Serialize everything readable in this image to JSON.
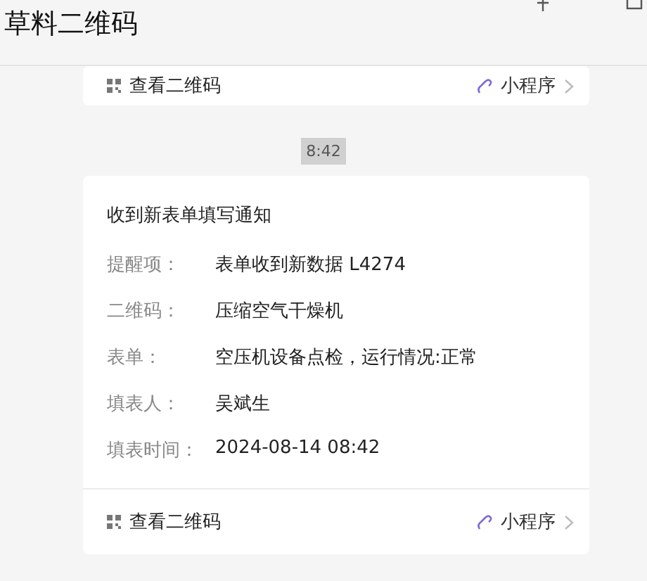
{
  "window": {
    "title": "草料二维码"
  },
  "messages": [
    {
      "kind": "footer_only",
      "footer": {
        "left": "查看二维码",
        "right": "小程序"
      }
    },
    {
      "kind": "time",
      "time": "8:42"
    },
    {
      "kind": "card",
      "title": "收到新表单填写通知",
      "fields": [
        {
          "label": "提醒项：",
          "value": "表单收到新数据 L4274"
        },
        {
          "label": "二维码：",
          "value": "压缩空气干燥机"
        },
        {
          "label": "表单：",
          "value": "空压机设备点检，运行情况:正常"
        },
        {
          "label": "填表人：",
          "value": "吴斌生"
        },
        {
          "label": "填表时间：",
          "value": "2024-08-14 08:42"
        }
      ],
      "footer": {
        "left": "查看二维码",
        "right": "小程序"
      }
    }
  ]
}
